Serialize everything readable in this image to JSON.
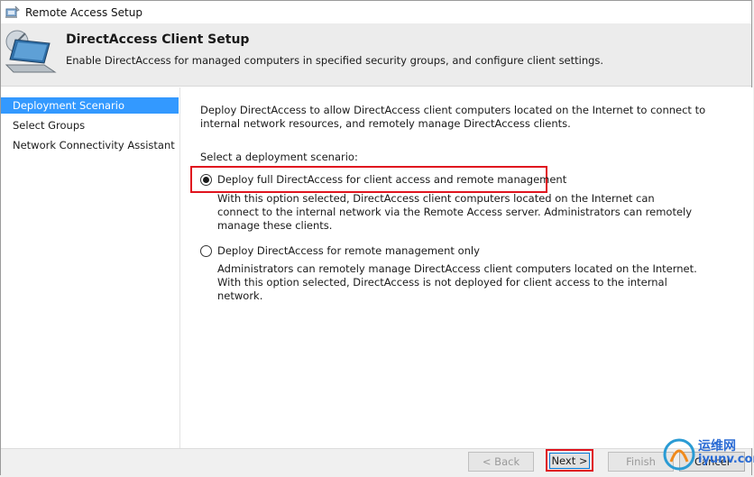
{
  "window": {
    "title": "Remote Access Setup"
  },
  "header": {
    "title": "DirectAccess Client Setup",
    "subtitle": "Enable DirectAccess for managed computers in specified security groups, and configure client settings."
  },
  "nav": {
    "items": [
      {
        "label": "Deployment Scenario",
        "selected": true
      },
      {
        "label": "Select Groups",
        "selected": false
      },
      {
        "label": "Network Connectivity Assistant",
        "selected": false
      }
    ]
  },
  "content": {
    "intro_line1": "Deploy DirectAccess to allow DirectAccess client computers located on the Internet to connect to",
    "intro_line2": "internal network resources, and remotely manage DirectAccess clients.",
    "select_label": "Select a deployment scenario:",
    "options": [
      {
        "label": "Deploy full DirectAccess for client access and remote management",
        "checked": true,
        "desc": [
          "With this option selected, DirectAccess client computers located on the Internet can",
          "connect to the internal network via the Remote Access server. Administrators can remotely",
          "manage these clients."
        ]
      },
      {
        "label": "Deploy DirectAccess for remote management only",
        "checked": false,
        "desc": [
          "Administrators can remotely manage DirectAccess client computers located on the Internet.",
          "With this option selected, DirectAccess is not deployed for client access to the internal",
          "network."
        ]
      }
    ]
  },
  "footer": {
    "back_label": "< Back",
    "next_label": "Next >",
    "finish_label": "Finish",
    "cancel_label": "Cancel"
  },
  "watermark": {
    "line1": "运维网",
    "line2": "iyunv.com"
  },
  "colors": {
    "selection": "#3399ff",
    "highlight": "#e0141e",
    "accent": "#0078d7"
  },
  "icons": {
    "app": "remote-access-icon",
    "header": "laptop-satellite-icon"
  }
}
